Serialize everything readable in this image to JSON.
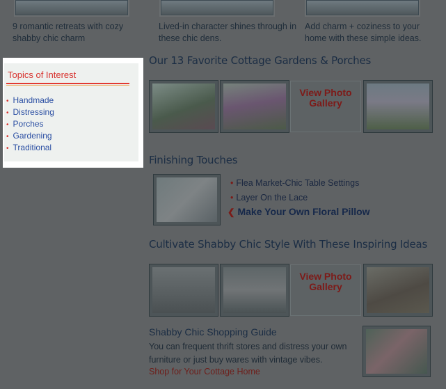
{
  "top_captions": [
    "9 romantic retreats with cozy shabby chic charm",
    "Lived-in character shines through in these chic dens.",
    "Add charm + coziness to your home with these simple ideas."
  ],
  "sidebar": {
    "title": "Topics of Interest",
    "topics": [
      "Handmade",
      "Distressing",
      "Porches",
      "Gardening",
      "Traditional"
    ]
  },
  "gardens": {
    "heading": "Our 13 Favorite Cottage Gardens & Porches",
    "gallery_line1": "View Photo",
    "gallery_line2": "Gallery"
  },
  "finishing": {
    "heading": "Finishing Touches",
    "items": [
      "Flea Market-Chic Table Settings",
      "Layer On the Lace",
      "Make Your Own Floral Pillow"
    ]
  },
  "cultivate": {
    "heading": "Cultivate Shabby Chic Style With These Inspiring Ideas",
    "gallery_line1": "View Photo",
    "gallery_line2": "Gallery"
  },
  "shopping": {
    "title": "Shabby Chic Shopping Guide",
    "description": "You can frequent thrift stores and distress your own furniture or just buy wares with vintage vibes.",
    "link": "Shop for Your Cottage Home"
  }
}
